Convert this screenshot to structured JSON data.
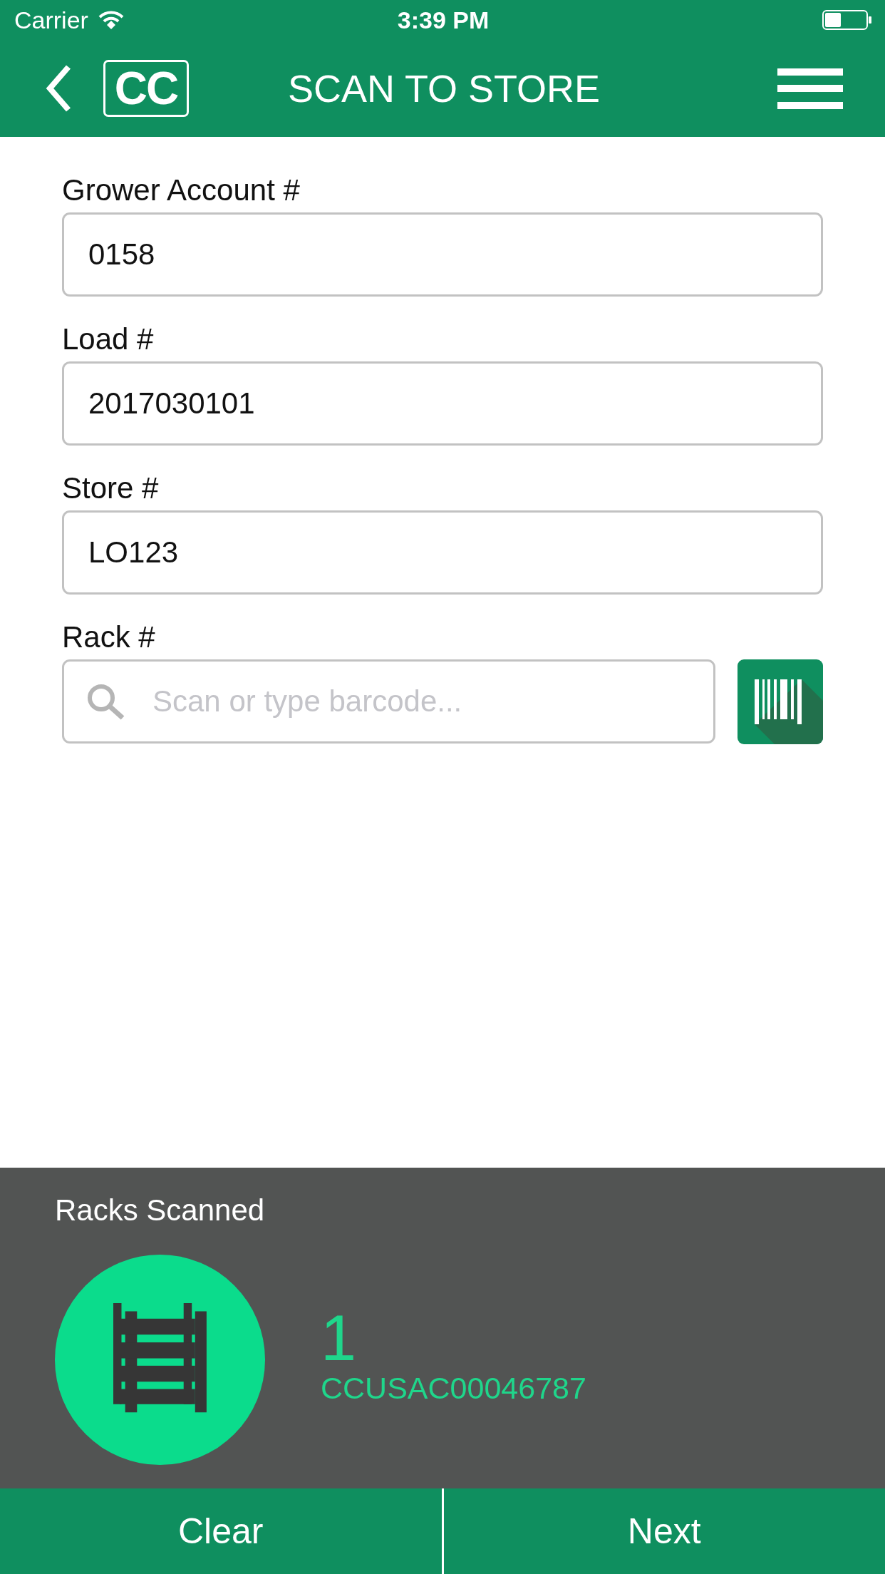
{
  "status_bar": {
    "carrier": "Carrier",
    "time": "3:39 PM"
  },
  "nav_bar": {
    "logo": "CC",
    "title": "SCAN TO STORE"
  },
  "form": {
    "fields": [
      {
        "kind": "text",
        "label": "Grower Account #",
        "value": "0158"
      },
      {
        "kind": "text",
        "label": "Load #",
        "value": "2017030101"
      },
      {
        "kind": "text",
        "label": "Store #",
        "value": "LO123"
      },
      {
        "kind": "scan",
        "label": "Rack #",
        "placeholder": "Scan or type barcode..."
      }
    ]
  },
  "scanned_panel": {
    "title": "Racks Scanned",
    "count": "1",
    "rack_code": "CCUSAC00046787"
  },
  "footer": {
    "buttons": [
      "Clear",
      "Next"
    ]
  }
}
